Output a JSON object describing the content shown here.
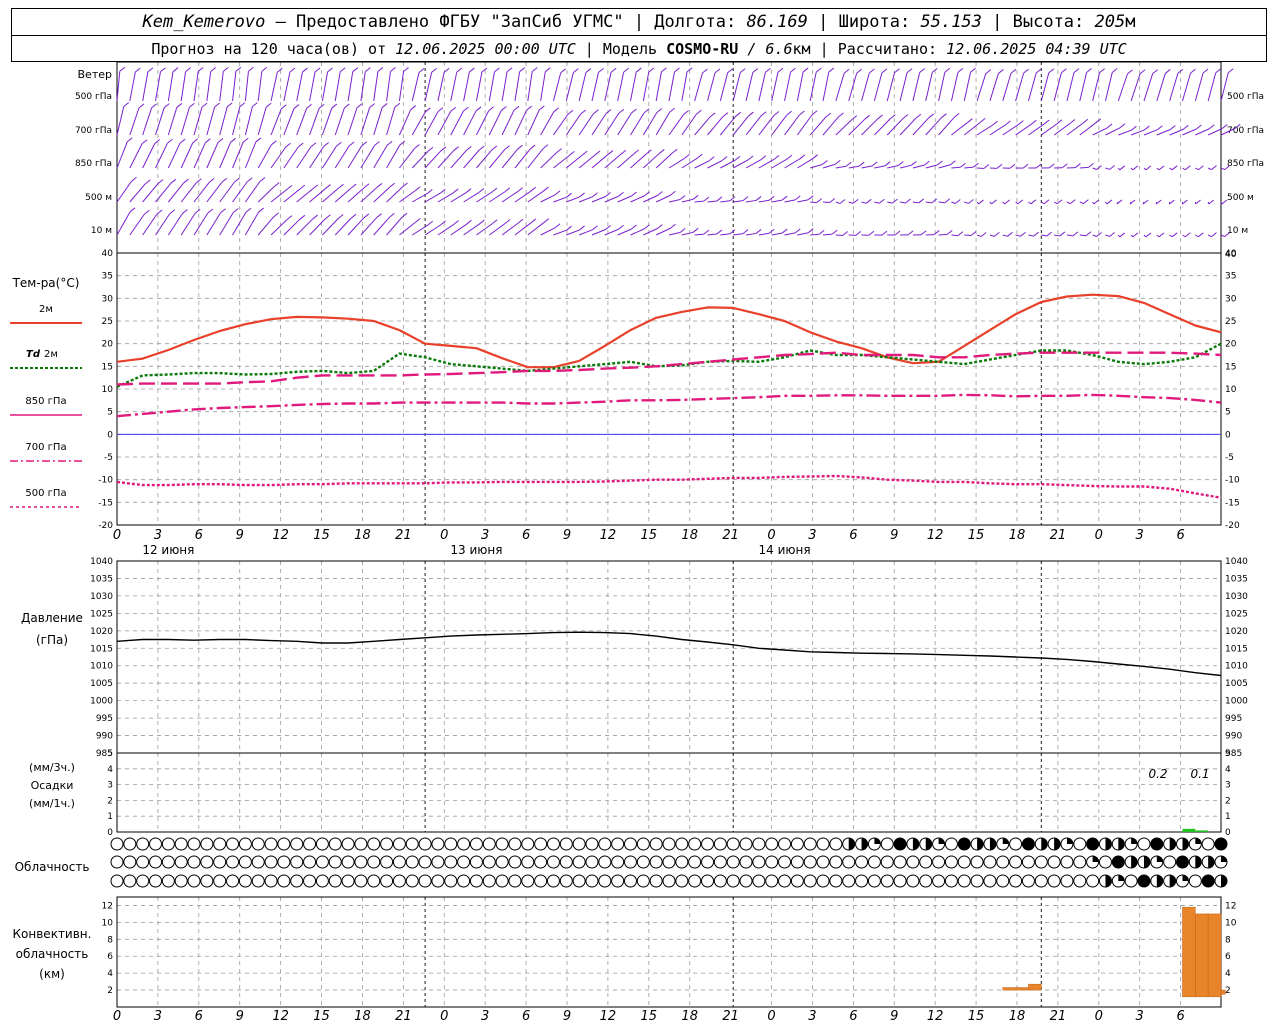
{
  "header": {
    "station": "Kem_Kemerovo",
    "provider": "— Предоставлено ФГБУ \"ЗапСиб УГМС\"",
    "lon_label": "Долгота:",
    "lon": "86.169",
    "lat_label": "Широта:",
    "lat": "55.153",
    "alt_label": "Высота:",
    "alt": "205",
    "alt_unit": "м",
    "forecast_prefix": "Прогноз на 120 часа(ов) от",
    "forecast_start": "12.06.2025 00:00 UTC",
    "model_label": "Модель",
    "model": "COSMO-RU",
    "model_res": "/ 6.6",
    "model_res_unit": "км",
    "computed_label": "Рассчитано:",
    "computed": "12.06.2025 04:39 UTC"
  },
  "panels": {
    "wind": {
      "title": "Ветер",
      "levels": [
        "500 гПа",
        "700 гПа",
        "850 гПа",
        "500 м",
        "10 м"
      ]
    },
    "temp": {
      "title": "Тем-ра(°C)",
      "legend": [
        "2м",
        "Td 2м",
        "850 гПа",
        "700 гПа",
        "500 гПа"
      ]
    },
    "pressure": {
      "title": "Давление",
      "unit": "(гПа)"
    },
    "precip": {
      "unit1": "(мм/3ч.)",
      "title": "Осадки",
      "unit2": "(мм/1ч.)",
      "labels": [
        "0.2",
        "0.1"
      ]
    },
    "cloud": {
      "title": "Облачность"
    },
    "conv": {
      "title1": "Конвективн.",
      "title2": "облачность",
      "unit": "(км)"
    }
  },
  "x_ticks": [
    "0",
    "3",
    "6",
    "9",
    "12",
    "15",
    "18",
    "21",
    "0",
    "3",
    "6",
    "9",
    "12",
    "15",
    "18",
    "21",
    "0",
    "3",
    "6",
    "9",
    "12",
    "15",
    "18",
    "21",
    "0",
    "3",
    "6"
  ],
  "dates": [
    "12 июня",
    "13 июня",
    "14 июня"
  ],
  "colors": {
    "wind": "#7a1fcf",
    "t2m": "#e8402a",
    "td": "#0a7a0a",
    "t850": "#e0197d",
    "t700": "#e0197d",
    "t500": "#e0197d",
    "pressure": "#000000",
    "zero": "#3a3ae0",
    "precip": "#22c022",
    "conv": "#e8852a"
  },
  "chart_data": [
    {
      "type": "line",
      "title": "Тем-ра(°C)",
      "x_unit": "hours from 12.06.2025 00:00 UTC",
      "ylim": [
        -20,
        40
      ],
      "x": [
        0,
        6,
        12,
        18,
        24,
        30,
        36,
        42,
        48,
        54,
        60,
        66,
        72,
        78,
        84,
        90,
        96,
        102,
        108,
        114,
        120,
        126,
        132,
        138,
        144,
        150,
        156,
        162,
        168,
        174,
        180,
        186,
        192,
        198,
        204,
        210,
        216,
        222,
        228,
        234,
        240,
        246,
        252,
        258
      ],
      "series": [
        {
          "name": "2м",
          "values": [
            16,
            16.7,
            18.6,
            20.8,
            22.8,
            24.3,
            25.4,
            25.9,
            25.8,
            25.5,
            25,
            23,
            20,
            19.5,
            19,
            16.8,
            14.8,
            14.8,
            16.2,
            19.5,
            23,
            25.7,
            27,
            28,
            27.9,
            26.5,
            25,
            22.5,
            20.5,
            19,
            17,
            15.7,
            16,
            19.5,
            23,
            26.5,
            29.2,
            30.4,
            30.8,
            30.5,
            29,
            26.5,
            24,
            22.5
          ]
        },
        {
          "name": "Td 2м",
          "values": [
            10.5,
            13,
            13.2,
            13.5,
            13.5,
            13.2,
            13.3,
            13.8,
            14,
            13.5,
            14,
            17.8,
            17,
            15.5,
            15,
            14.5,
            14,
            14.5,
            15,
            15.5,
            16,
            15,
            15.2,
            16,
            16.2,
            16,
            17,
            18.5,
            17.5,
            17.5,
            17,
            16.5,
            16,
            15.5,
            16.5,
            17.5,
            18.5,
            18.5,
            17.5,
            16,
            15.5,
            16,
            17,
            20
          ]
        },
        {
          "name": "850 гПа",
          "values": [
            11,
            11.2,
            11.2,
            11.2,
            11.2,
            11.5,
            11.7,
            12.5,
            13,
            13,
            13,
            13,
            13.2,
            13.3,
            13.5,
            13.7,
            14,
            14,
            14.2,
            14.5,
            14.7,
            15,
            15.5,
            16,
            16.5,
            17,
            17.5,
            17.7,
            18,
            17.5,
            17.5,
            17.5,
            17,
            17,
            17.5,
            17.8,
            18,
            18,
            18,
            18,
            18,
            18,
            17.8,
            17.5
          ]
        },
        {
          "name": "700 гПа",
          "values": [
            4,
            4.5,
            5,
            5.5,
            5.8,
            6,
            6.2,
            6.5,
            6.7,
            6.8,
            6.8,
            7,
            7,
            7,
            7,
            7,
            6.8,
            6.8,
            7,
            7.2,
            7.5,
            7.5,
            7.6,
            7.8,
            8,
            8.2,
            8.5,
            8.5,
            8.6,
            8.6,
            8.5,
            8.5,
            8.5,
            8.7,
            8.6,
            8.4,
            8.5,
            8.5,
            8.7,
            8.5,
            8.2,
            8,
            7.6,
            7
          ]
        },
        {
          "name": "500 гПа",
          "values": [
            -10.5,
            -11.2,
            -11.2,
            -11,
            -11,
            -11.2,
            -11.2,
            -11,
            -11,
            -10.8,
            -10.8,
            -10.8,
            -10.8,
            -10.6,
            -10.6,
            -10.5,
            -10.5,
            -10.5,
            -10.5,
            -10.4,
            -10.2,
            -10,
            -10,
            -9.8,
            -9.6,
            -9.6,
            -9.4,
            -9.3,
            -9.2,
            -9.5,
            -10,
            -10.2,
            -10.5,
            -10.5,
            -10.8,
            -11,
            -11,
            -11.2,
            -11.4,
            -11.5,
            -11.5,
            -12,
            -13,
            -14
          ]
        }
      ]
    },
    {
      "type": "line",
      "title": "Давление",
      "ylabel": "(гПа)",
      "x_unit": "hours from 12.06.2025 00:00 UTC",
      "ylim": [
        985,
        1040
      ],
      "x": [
        0,
        6,
        12,
        18,
        24,
        30,
        36,
        42,
        48,
        54,
        60,
        66,
        72,
        78,
        84,
        90,
        96,
        102,
        108,
        114,
        120,
        126,
        132,
        138,
        144,
        150,
        156,
        162,
        168,
        174,
        180,
        186,
        192,
        198,
        204,
        210,
        216,
        222,
        228,
        234,
        240,
        246,
        252,
        258
      ],
      "series": [
        {
          "name": "Давление",
          "values": [
            1017,
            1017.5,
            1017.5,
            1017.3,
            1017.5,
            1017.5,
            1017.2,
            1017,
            1016.5,
            1016.5,
            1017,
            1017.5,
            1018,
            1018.5,
            1018.8,
            1019,
            1019.2,
            1019.5,
            1019.6,
            1019.5,
            1019.2,
            1018.5,
            1017.5,
            1016.8,
            1016,
            1015,
            1014.5,
            1014,
            1013.8,
            1013.6,
            1013.5,
            1013.4,
            1013.2,
            1013,
            1012.8,
            1012.5,
            1012.2,
            1011.8,
            1011.2,
            1010.5,
            1009.8,
            1009,
            1008,
            1007.2
          ]
        }
      ]
    },
    {
      "type": "bar",
      "title": "Осадки",
      "ylabel": "(мм/3ч.) (мм/1ч.)",
      "ylim": [
        0,
        5
      ],
      "x": [
        249,
        252,
        255
      ],
      "values": [
        0.2,
        0.1,
        0
      ]
    },
    {
      "type": "bar",
      "title": "Конвективн. облачность",
      "ylabel": "(км)",
      "ylim": [
        0,
        13
      ],
      "bars": [
        {
          "x0": 207,
          "x1": 213,
          "bottom": 2,
          "top": 2.3
        },
        {
          "x0": 213,
          "x1": 216,
          "bottom": 2,
          "top": 2.7
        },
        {
          "x0": 249,
          "x1": 252,
          "bottom": 1.2,
          "top": 11.8
        },
        {
          "x0": 252,
          "x1": 255,
          "bottom": 1.2,
          "top": 11
        },
        {
          "x0": 255,
          "x1": 258,
          "bottom": 1.2,
          "top": 11
        },
        {
          "x0": 258,
          "x1": 259,
          "bottom": 1.5,
          "top": 2
        }
      ]
    }
  ]
}
